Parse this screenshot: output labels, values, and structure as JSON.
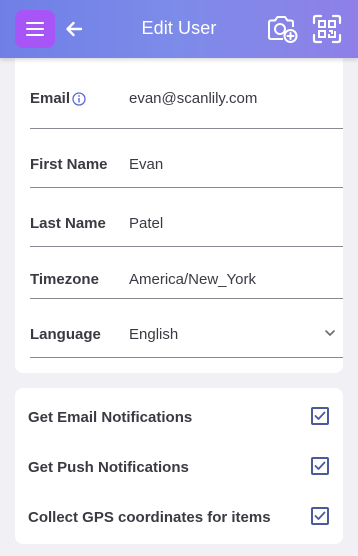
{
  "header": {
    "title": "Edit User",
    "menu_icon": "hamburger-menu-icon",
    "back_icon": "arrow-left-icon",
    "camera_icon": "camera-add-icon",
    "scan_icon": "qr-scan-icon",
    "gradient_start": "#6f7fe6",
    "gradient_end": "#8e80e8",
    "menu_button_color": "#a855f7"
  },
  "user_form": {
    "email": {
      "label": "Email",
      "value": "evan@scanlily.com",
      "info_icon": "info-icon"
    },
    "first_name": {
      "label": "First Name",
      "value": "Evan"
    },
    "last_name": {
      "label": "Last Name",
      "value": "Patel"
    },
    "timezone": {
      "label": "Timezone",
      "value": "America/New_York"
    },
    "language": {
      "label": "Language",
      "value": "English",
      "dropdown_icon": "chevron-down-icon"
    }
  },
  "notifications": {
    "items": [
      {
        "label": "Get Email Notifications",
        "checked": true
      },
      {
        "label": "Get Push Notifications",
        "checked": true
      },
      {
        "label": "Collect GPS coordinates for items",
        "checked": true
      }
    ],
    "checkbox_color": "#4a5a9a"
  }
}
